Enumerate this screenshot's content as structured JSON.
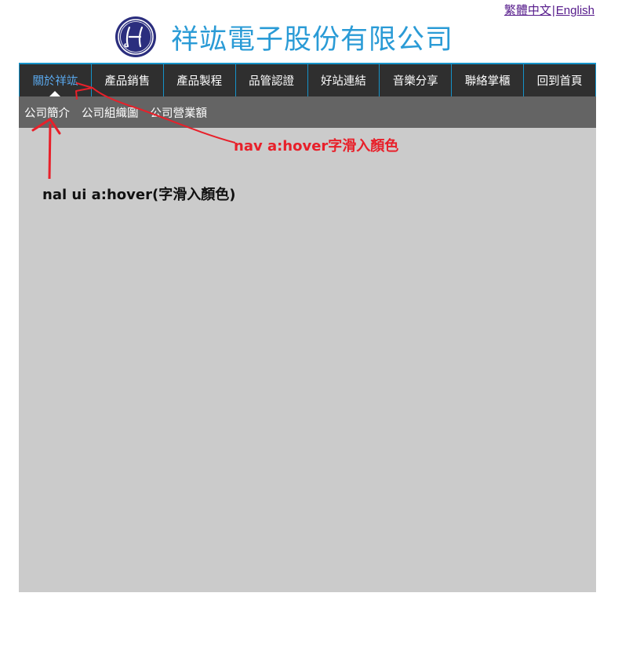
{
  "lang": {
    "traditional_chinese": "繁體中文",
    "separator": "|",
    "english": "English"
  },
  "header": {
    "logo_icon": "seal-logo-icon",
    "company_name": "祥竑電子股份有限公司"
  },
  "nav": {
    "items": [
      {
        "label": "關於祥竑",
        "active": true
      },
      {
        "label": "產品銷售"
      },
      {
        "label": "產品製程"
      },
      {
        "label": "品管認證"
      },
      {
        "label": "好站連結"
      },
      {
        "label": "音樂分享"
      },
      {
        "label": "聯絡掌櫃"
      },
      {
        "label": "回到首頁"
      }
    ]
  },
  "subnav": {
    "items": [
      {
        "label": "公司簡介"
      },
      {
        "label": "公司組織圖"
      },
      {
        "label": "公司營業額"
      }
    ]
  },
  "annotations": {
    "nav_hover": "nav a:hover字滑入顏色",
    "subnav_hover": "nal ui a:hover(字滑入顏色)"
  },
  "colors": {
    "accent_blue": "#1593c9",
    "nav_bg": "#2f2f2f",
    "subnav_bg": "#646464",
    "content_bg": "#cbcbcb",
    "company_name": "#2a9bd6",
    "annotation_red": "#e8202a"
  }
}
